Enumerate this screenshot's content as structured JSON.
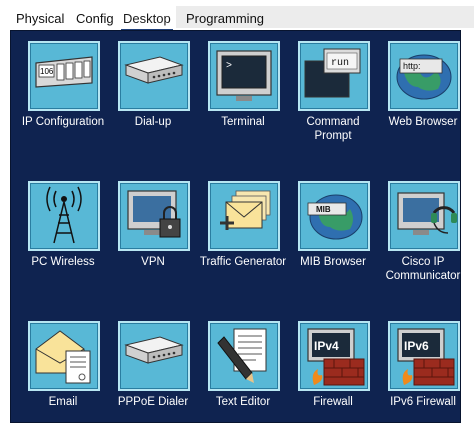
{
  "tabs": [
    {
      "label": "Physical",
      "active": false
    },
    {
      "label": "Config",
      "active": false
    },
    {
      "label": "Desktop",
      "active": true
    },
    {
      "label": "Programming",
      "active": false
    }
  ],
  "apps": [
    {
      "label": "IP Configuration",
      "icon": "ip-configuration-icon"
    },
    {
      "label": "Dial-up",
      "icon": "modem-icon"
    },
    {
      "label": "Terminal",
      "icon": "terminal-icon"
    },
    {
      "label": "Command Prompt",
      "icon": "command-prompt-icon"
    },
    {
      "label": "Web Browser",
      "icon": "web-browser-icon"
    },
    {
      "label": "PC Wireless",
      "icon": "wireless-tower-icon"
    },
    {
      "label": "VPN",
      "icon": "vpn-lock-icon"
    },
    {
      "label": "Traffic Generator",
      "icon": "traffic-generator-icon"
    },
    {
      "label": "MIB Browser",
      "icon": "mib-browser-icon"
    },
    {
      "label": "Cisco IP Communicator",
      "icon": "ip-communicator-icon"
    },
    {
      "label": "Email",
      "icon": "email-icon"
    },
    {
      "label": "PPPoE Dialer",
      "icon": "pppoe-dialer-icon"
    },
    {
      "label": "Text Editor",
      "icon": "text-editor-icon"
    },
    {
      "label": "Firewall",
      "icon": "firewall-icon"
    },
    {
      "label": "IPv6 Firewall",
      "icon": "ipv6-firewall-icon"
    }
  ],
  "icon_text": {
    "ip_config_digits": "106",
    "command_prompt": "run",
    "web_browser": "http:",
    "mib": "MIB",
    "firewall": "IPv4",
    "ipv6_firewall": "IPv6"
  },
  "colors": {
    "panel_background": "#0f2350",
    "tile_background": "#58b8d6",
    "label_text": "#ffffff",
    "active_tab_underline": "#1f3f7a"
  }
}
